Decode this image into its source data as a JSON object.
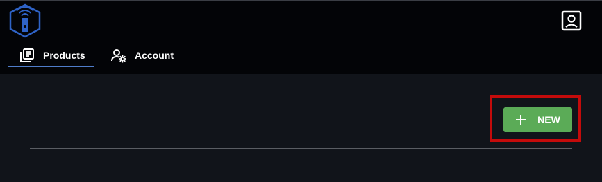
{
  "header": {
    "logo_icon": "wifi-phone-hexagon-logo",
    "profile_icon": "user-portrait-icon",
    "accent_color": "#4f7cc9"
  },
  "nav": {
    "tabs": [
      {
        "label": "Products",
        "icon": "product-list-icon",
        "active": true
      },
      {
        "label": "Account",
        "icon": "account-settings-icon",
        "active": false
      }
    ]
  },
  "toolbar": {
    "new_label": "NEW",
    "new_icon": "plus-icon",
    "new_color": "#5bab57",
    "highlight_color": "#c40b0b"
  }
}
